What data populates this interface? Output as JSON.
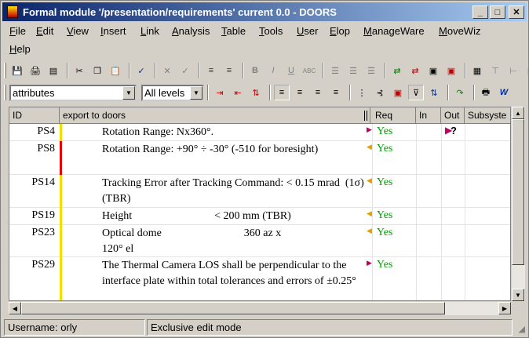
{
  "window": {
    "title": "Formal module '/presentation/requirements' current 0.0 - DOORS"
  },
  "menu": {
    "items": [
      "File",
      "Edit",
      "View",
      "Insert",
      "Link",
      "Analysis",
      "Table",
      "Tools",
      "User",
      "Elop",
      "ManageWare",
      "MoveWiz",
      "Help"
    ]
  },
  "toolbar2": {
    "view_combo": "attributes",
    "level_combo": "All levels"
  },
  "columns": {
    "id": "ID",
    "main": "export to doors",
    "req": "Req",
    "in": "In",
    "out": "Out",
    "subsystem": "Subsyste"
  },
  "out_marker": "?",
  "rows": [
    {
      "id": "PS4",
      "text": "Rotation Range: Nx360°.",
      "req": "Yes",
      "bar_color": "#f0e000"
    },
    {
      "id": "PS8",
      "text": "Rotation Range: +90° ÷ -30° (-510 for boresight)",
      "req": "Yes",
      "bar_color": "#e00000"
    },
    {
      "id": "PS14",
      "text": "Tracking Error after Tracking Command: < 0.15 mrad  (1σ) (TBR)",
      "req": "Yes",
      "bar_color": "#f0e000"
    },
    {
      "id": "PS19",
      "text": "Height                              < 200 mm (TBR)",
      "req": "Yes",
      "bar_color": "#f0e000"
    },
    {
      "id": "PS23",
      "text": "Optical dome                              360 az x\n120° el",
      "req": "Yes",
      "bar_color": "#f0e000"
    },
    {
      "id": "PS29",
      "text": "The Thermal Camera LOS shall be perpendicular to the interface plate within total tolerances and errors of ±0.25°",
      "req": "Yes",
      "bar_color": "#f0e000"
    }
  ],
  "status": {
    "user": "Username: orly",
    "mode": "Exclusive edit mode"
  }
}
